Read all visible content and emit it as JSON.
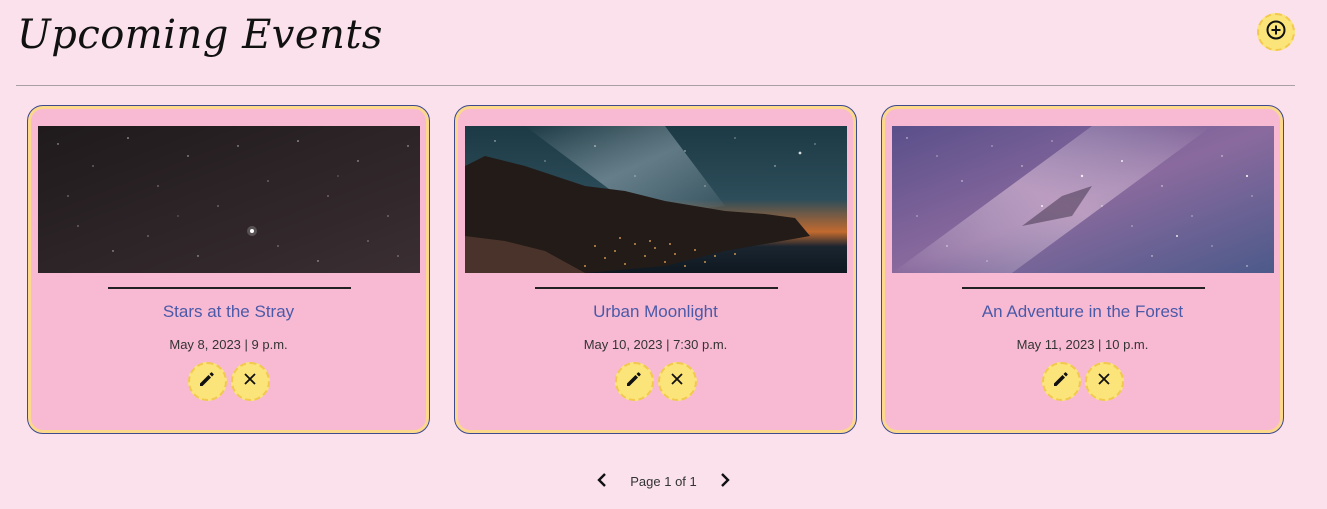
{
  "header": {
    "title": "Upcoming Events",
    "add_icon": "plus-circle-icon"
  },
  "events": [
    {
      "title": "Stars at the Stray",
      "date": "May 8, 2023 | 9 p.m.",
      "image": "night-sky-stars"
    },
    {
      "title": "Urban Moonlight",
      "date": "May 10, 2023 | 7:30 p.m.",
      "image": "city-lights-milky-way"
    },
    {
      "title": "An Adventure in the Forest",
      "date": "May 11, 2023 | 10 p.m.",
      "image": "purple-milky-way"
    }
  ],
  "pagination": {
    "label": "Page 1 of 1",
    "prev_icon": "chevron-left-icon",
    "next_icon": "chevron-right-icon"
  },
  "colors": {
    "background": "#fae1ec",
    "card": "#f8bad3",
    "card_border": "#3d4a8c",
    "card_inner_border": "#fbd88c",
    "button": "#fbe47a",
    "title_text": "#4a5aa8"
  }
}
